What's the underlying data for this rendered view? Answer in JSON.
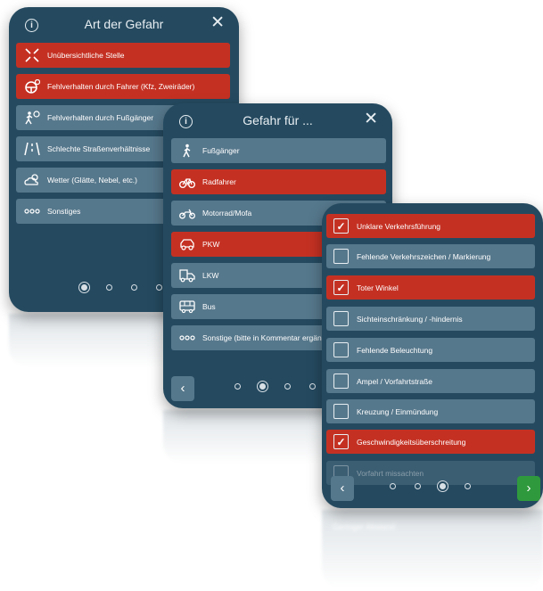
{
  "panel1": {
    "title": "Art der Gefahr",
    "items": [
      {
        "label": "Unübersichtliche Stelle",
        "selected": true,
        "icon": "crossroads-icon"
      },
      {
        "label": "Fehlverhalten durch Fahrer (Kfz, Zweiräder)",
        "selected": true,
        "icon": "steering-wheel-icon"
      },
      {
        "label": "Fehlverhalten durch Fußgänger",
        "selected": false,
        "icon": "pedestrian-warning-icon"
      },
      {
        "label": "Schlechte Straßenverhältnisse",
        "selected": false,
        "icon": "road-icon"
      },
      {
        "label": "Wetter (Glätte, Nebel, etc.)",
        "selected": false,
        "icon": "weather-icon"
      },
      {
        "label": "Sonstiges",
        "selected": false,
        "icon": "more-dots-icon"
      }
    ],
    "active_page": 1
  },
  "panel2": {
    "title": "Gefahr für ...",
    "items": [
      {
        "label": "Fußgänger",
        "selected": false,
        "icon": "pedestrian-icon"
      },
      {
        "label": "Radfahrer",
        "selected": true,
        "icon": "bicycle-icon"
      },
      {
        "label": "Motorrad/Mofa",
        "selected": false,
        "icon": "motorcycle-icon"
      },
      {
        "label": "PKW",
        "selected": true,
        "icon": "car-icon"
      },
      {
        "label": "LKW",
        "selected": false,
        "icon": "truck-icon"
      },
      {
        "label": "Bus",
        "selected": false,
        "icon": "bus-icon"
      },
      {
        "label": "Sonstige (bitte in Kommentar ergänzen)",
        "selected": false,
        "icon": "more-dots-icon"
      }
    ],
    "active_page": 2,
    "back_label": "‹"
  },
  "panel3": {
    "items": [
      {
        "label": "Unklare Verkehrsführung",
        "checked": true
      },
      {
        "label": "Fehlende Verkehrszeichen / Markierung",
        "checked": false
      },
      {
        "label": "Toter Winkel",
        "checked": true
      },
      {
        "label": "Sichteinschränkung / -hindernis",
        "checked": false
      },
      {
        "label": "Fehlende Beleuchtung",
        "checked": false
      },
      {
        "label": "Ampel / Vorfahrtstraße",
        "checked": false
      },
      {
        "label": "Kreuzung / Einmündung",
        "checked": false
      },
      {
        "label": "Geschwindigkeitsüberschreitung",
        "checked": true
      },
      {
        "label": "Vorfahrt missachten",
        "checked": false
      }
    ],
    "active_page": 3,
    "back_label": "‹",
    "next_label": "›"
  },
  "reflection": {
    "text": "Geringer Abstand"
  },
  "colors": {
    "panel_bg": "#254a60",
    "item_bg": "#56788c",
    "selected_bg": "#c43123",
    "next_bg": "#2f9a3d"
  }
}
